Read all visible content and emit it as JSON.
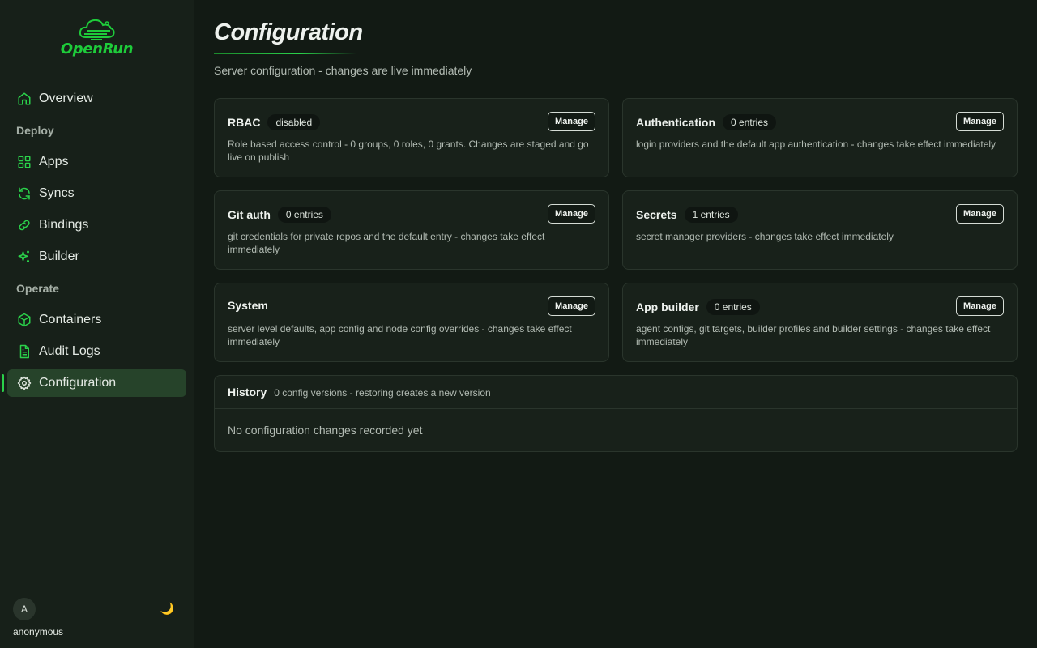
{
  "brand": {
    "name": "OpenRun",
    "accent": "#1ecb3a"
  },
  "nav": {
    "overview": "Overview",
    "sections": {
      "deploy": "Deploy",
      "operate": "Operate"
    },
    "items": {
      "apps": "Apps",
      "syncs": "Syncs",
      "bindings": "Bindings",
      "builder": "Builder",
      "containers": "Containers",
      "audit_logs": "Audit Logs",
      "configuration": "Configuration"
    },
    "active": "Configuration"
  },
  "user": {
    "initial": "A",
    "name": "anonymous",
    "theme_icon": "🌙"
  },
  "page": {
    "title": "Configuration",
    "subtitle": "Server configuration - changes are live immediately"
  },
  "cards": [
    {
      "title": "RBAC",
      "badge": "disabled",
      "button": "Manage",
      "description": "Role based access control - 0 groups, 0 roles, 0 grants. Changes are staged and go live on publish"
    },
    {
      "title": "Authentication",
      "badge": "0 entries",
      "button": "Manage",
      "description": "login providers and the default app authentication - changes take effect immediately"
    },
    {
      "title": "Git auth",
      "badge": "0 entries",
      "button": "Manage",
      "description": "git credentials for private repos and the default entry - changes take effect immediately"
    },
    {
      "title": "Secrets",
      "badge": "1 entries",
      "button": "Manage",
      "description": "secret manager providers - changes take effect immediately"
    },
    {
      "title": "System",
      "badge": "",
      "button": "Manage",
      "description": "server level defaults, app config and node config overrides - changes take effect immediately"
    },
    {
      "title": "App builder",
      "badge": "0 entries",
      "button": "Manage",
      "description": "agent configs, git targets, builder profiles and builder settings - changes take effect immediately"
    }
  ],
  "history": {
    "title": "History",
    "subtitle": "0 config versions - restoring creates a new version",
    "empty": "No configuration changes recorded yet"
  }
}
